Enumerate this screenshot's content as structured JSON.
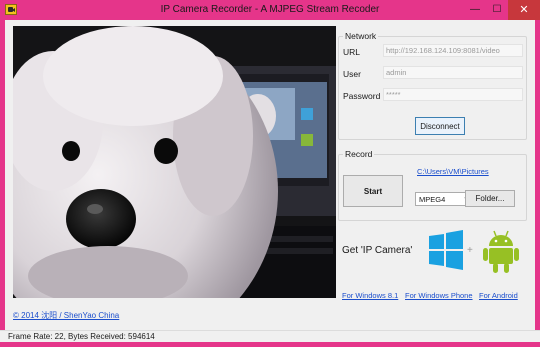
{
  "window": {
    "title": "IP Camera Recorder - A MJPEG Stream Recoder",
    "minimize_glyph": "—",
    "maximize_glyph": "☐",
    "close_glyph": "✕",
    "frame_color": "#e5358a",
    "close_color": "#c7373c"
  },
  "network": {
    "group_label": "Network",
    "url_label": "URL",
    "url_value": "http://192.168.124.109:8081/video",
    "user_label": "User",
    "user_value": "admin",
    "password_label": "Password",
    "password_value": "*****",
    "disconnect_label": "Disconnect"
  },
  "record": {
    "group_label": "Record",
    "path_link": "C:\\Users\\VM\\Pictures",
    "start_label": "Start",
    "codec_value": "MPEG4",
    "folder_label": "Folder..."
  },
  "promo": {
    "get_text": "Get 'IP Camera'",
    "plus": "+",
    "windows_icon": "windows-logo-icon",
    "android_icon": "android-logo-icon",
    "links": [
      "For Windows 8.1",
      "For Windows Phone",
      "For Android"
    ]
  },
  "credit": "© 2014 沈阳 / ShenYao China",
  "status": "Frame Rate: 22, Bytes Received: 594614",
  "colors": {
    "link": "#1b4ecc",
    "windows_blue": "#1aa1e1",
    "android_green": "#97c024"
  }
}
